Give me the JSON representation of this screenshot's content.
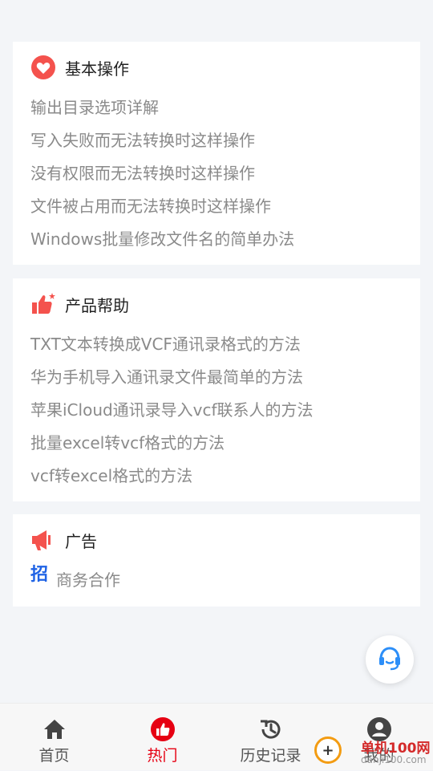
{
  "sections": {
    "basic": {
      "title": "基本操作",
      "items": [
        "输出目录选项详解",
        "写入失败而无法转换时这样操作",
        "没有权限而无法转换时这样操作",
        "文件被占用而无法转换时这样操作",
        "Windows批量修改文件名的简单办法"
      ]
    },
    "help": {
      "title": "产品帮助",
      "items": [
        "TXT文本转换成VCF通讯录格式的方法",
        "华为手机导入通讯录文件最简单的方法",
        "苹果iCloud通讯录导入vcf联系人的方法",
        "批量excel转vcf格式的方法",
        "vcf转excel格式的方法"
      ]
    },
    "ads": {
      "title": "广告",
      "badge": "招",
      "item": "商务合作"
    }
  },
  "tabbar": {
    "tabs": [
      {
        "label": "首页",
        "icon": "home-icon"
      },
      {
        "label": "热门",
        "icon": "thumbs-up-icon",
        "active": true
      },
      {
        "label": "历史记录",
        "icon": "history-icon"
      },
      {
        "label": "我的",
        "icon": "user-icon"
      }
    ]
  },
  "watermark": {
    "text": "单机100网",
    "url": "danji100.com"
  },
  "colors": {
    "accent": "#e60012",
    "heart": "#f4524d",
    "badge_blue": "#1f63e5",
    "support_blue": "#2c8ef8"
  }
}
